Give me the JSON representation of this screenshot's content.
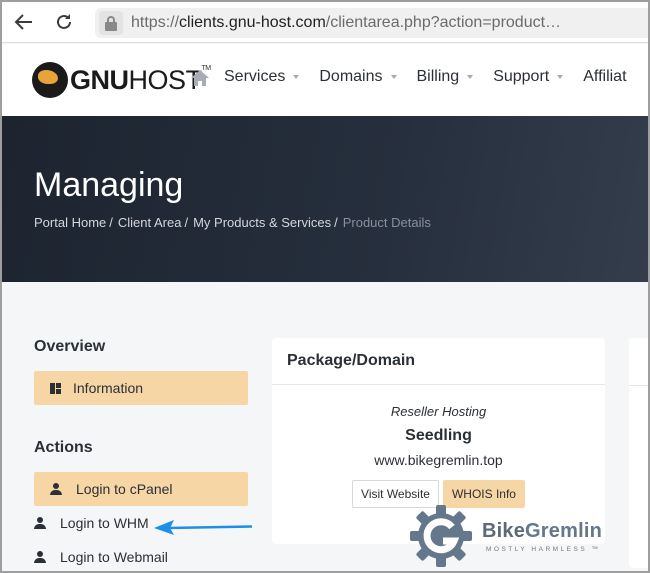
{
  "browser": {
    "url_prefix": "https://",
    "url_host": "clients.gnu-host.com",
    "url_rest": "/clientarea.php?action=product…",
    "back_icon": "arrow-left-icon",
    "reload_icon": "reload-icon",
    "lock_icon": "lock-icon"
  },
  "site": {
    "logo_bold": "GNU",
    "logo_light": "HOST",
    "logo_tm": "TM",
    "home_icon": "home-icon",
    "menu": [
      {
        "label": "Services",
        "has_caret": true
      },
      {
        "label": "Domains",
        "has_caret": true
      },
      {
        "label": "Billing",
        "has_caret": true
      },
      {
        "label": "Support",
        "has_caret": true
      },
      {
        "label": "Affiliat",
        "has_caret": false
      }
    ]
  },
  "hero": {
    "title": "Managing",
    "breadcrumb": [
      "Portal Home",
      "Client Area",
      "My Products & Services",
      "Product Details"
    ],
    "separator": "/"
  },
  "sidebar": {
    "overview_heading": "Overview",
    "overview_items": [
      {
        "label": "Information",
        "icon": "dashboard-icon",
        "active": true
      }
    ],
    "actions_heading": "Actions",
    "action_items": [
      {
        "label": "Login to cPanel",
        "icon": "user-icon",
        "active": true
      },
      {
        "label": "Login to WHM",
        "icon": "user-icon",
        "active": false
      },
      {
        "label": "Login to Webmail",
        "icon": "user-icon",
        "active": false
      }
    ]
  },
  "card": {
    "title": "Package/Domain",
    "package_type": "Reseller Hosting",
    "package_name": "Seedling",
    "domain": "www.bikegremlin.top",
    "buttons": {
      "visit": "Visit Website",
      "whois": "WHOIS Info"
    }
  },
  "watermark": {
    "title_a": "Bike",
    "title_b": "Gremlin",
    "subtitle": "MOSTLY HARMLESS ™"
  },
  "colors": {
    "accent": "#f7d6a5",
    "hero_dark": "#1d2430",
    "annotation_arrow": "#1e8fe6",
    "text": "#2b2f36"
  }
}
